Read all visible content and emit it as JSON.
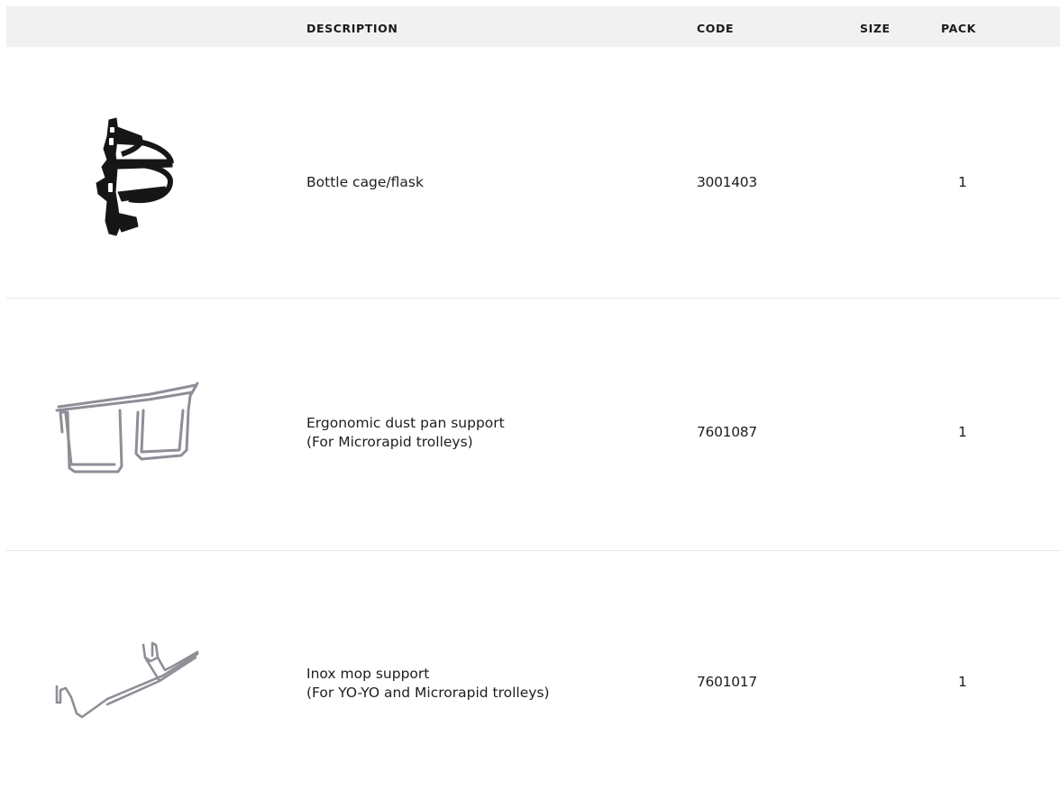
{
  "table": {
    "headers": {
      "image": "",
      "description": "DESCRIPTION",
      "code": "CODE",
      "size": "SIZE",
      "pack": "PACK"
    },
    "rows": [
      {
        "image_icon": "bottle-cage-icon",
        "description": [
          "Bottle cage/flask"
        ],
        "code": "3001403",
        "size": "",
        "pack": "1"
      },
      {
        "image_icon": "dust-pan-support-icon",
        "description": [
          "Ergonomic dust pan support",
          "(For Microrapid trolleys)"
        ],
        "code": "7601087",
        "size": "",
        "pack": "1"
      },
      {
        "image_icon": "mop-support-icon",
        "description": [
          "Inox mop support",
          "(For YO-YO and Microrapid trolleys)"
        ],
        "code": "7601017",
        "size": "",
        "pack": "1"
      }
    ]
  },
  "colors": {
    "header_bg": "#f1f1f1",
    "divider": "#e8e8e8",
    "text": "#1a1a1a"
  }
}
